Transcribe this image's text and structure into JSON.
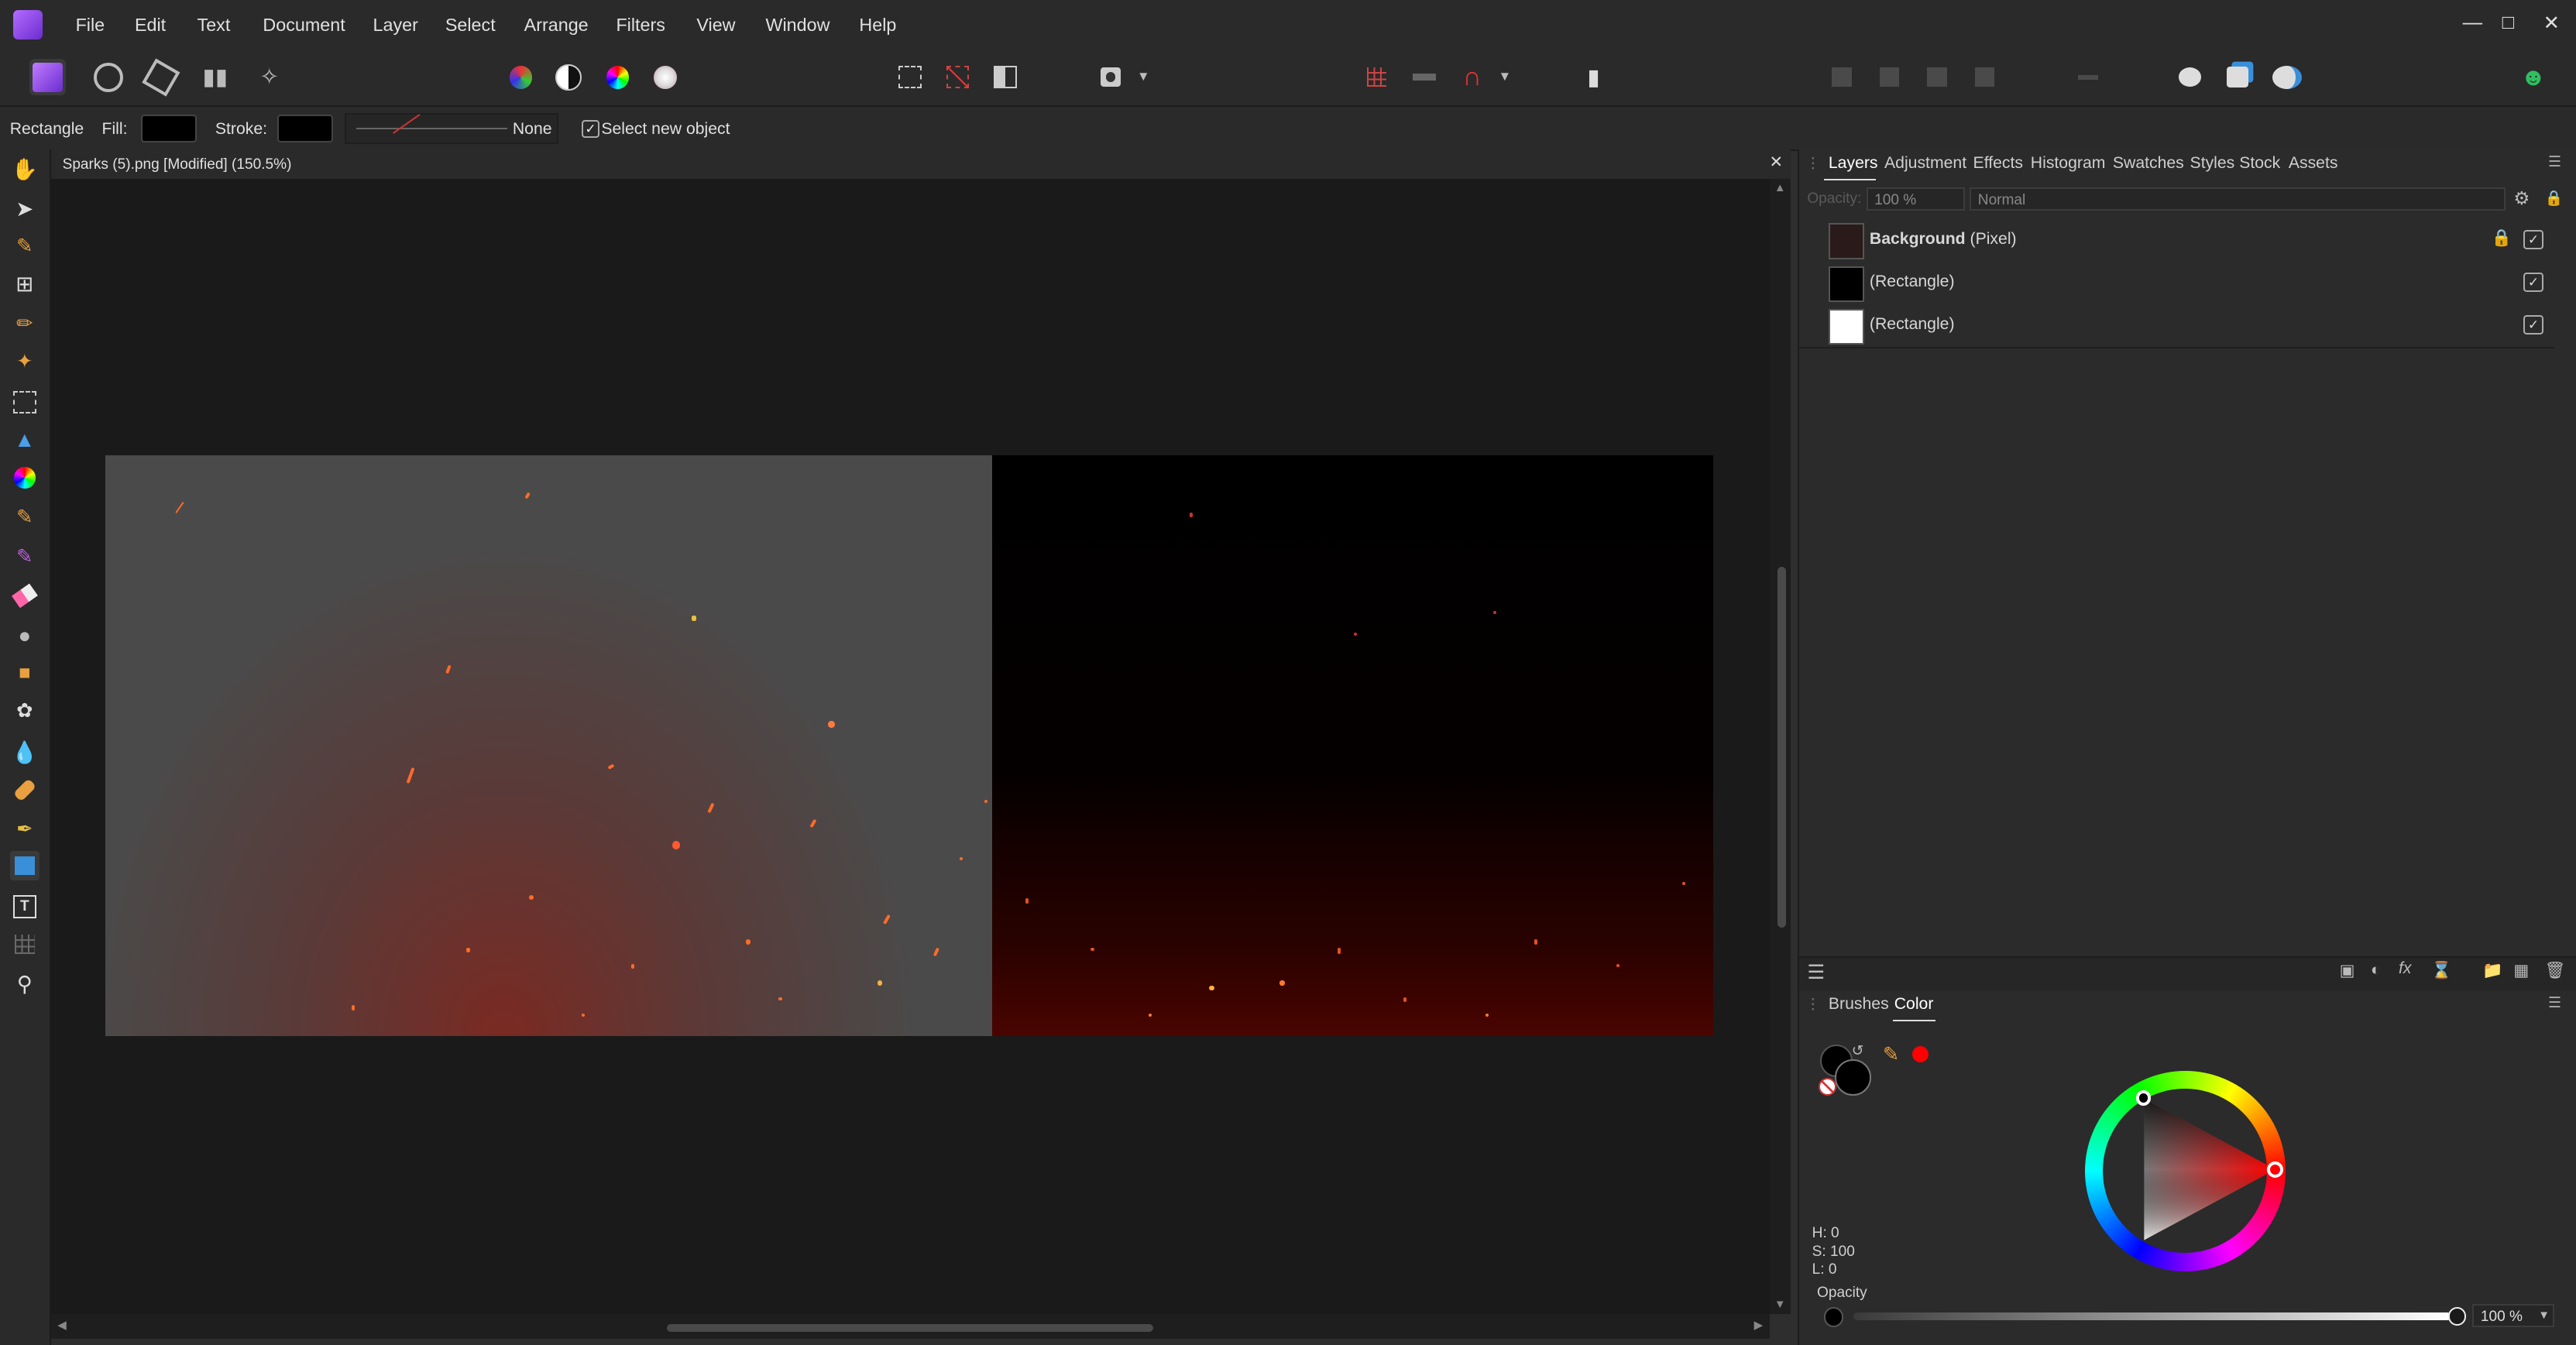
{
  "menu": [
    "File",
    "Edit",
    "Text",
    "Document",
    "Layer",
    "Select",
    "Arrange",
    "Filters",
    "View",
    "Window",
    "Help"
  ],
  "context": {
    "tool_name": "Rectangle",
    "fill_label": "Fill:",
    "stroke_label": "Stroke:",
    "stroke_style": "None",
    "select_new_object": "Select new object"
  },
  "document": {
    "title": "Sparks (5).png [Modified] (150.5%)"
  },
  "panel_tabs": [
    "Layers",
    "Adjustment",
    "Effects",
    "Histogram",
    "Swatches",
    "Styles",
    "Stock",
    "Assets"
  ],
  "layers_options": {
    "opacity_label": "Opacity:",
    "opacity_value": "100 %",
    "blend_mode": "Normal"
  },
  "layers": [
    {
      "name": "Background",
      "type": "(Pixel)",
      "locked": true,
      "visible": true,
      "thumb": "#2a1a1a"
    },
    {
      "name": "",
      "type": "(Rectangle)",
      "locked": false,
      "visible": true,
      "thumb": "#000000"
    },
    {
      "name": "",
      "type": "(Rectangle)",
      "locked": false,
      "visible": true,
      "thumb": "#ffffff"
    }
  ],
  "lower_tabs": [
    "Brushes",
    "Color"
  ],
  "color": {
    "h": "H: 0",
    "s": "S: 100",
    "l": "L: 0",
    "opacity_label": "Opacity",
    "opacity_value": "100 %",
    "selected_hue": "#ff0000"
  },
  "icons": {
    "window_min": "minimize-icon",
    "window_max": "maximize-icon",
    "window_close": "close-icon"
  }
}
